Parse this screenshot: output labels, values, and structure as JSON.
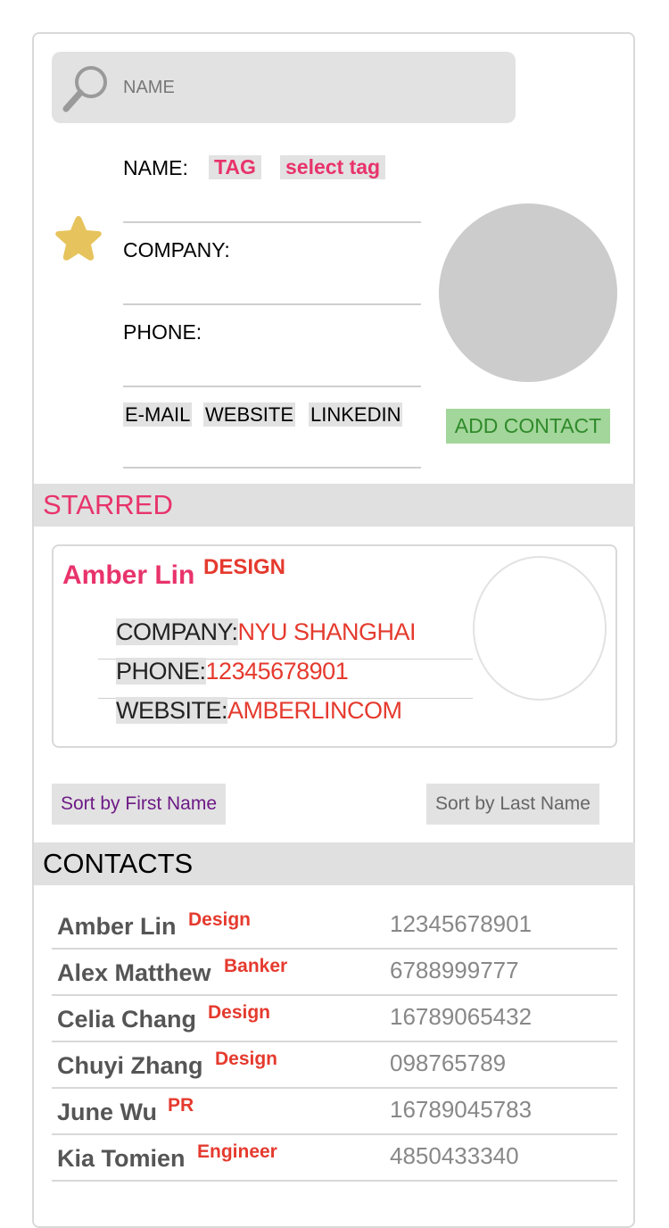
{
  "search": {
    "placeholder": "NAME"
  },
  "form": {
    "name_label": "NAME:",
    "tag_label": "TAG",
    "select_tag_label": "select tag",
    "company_label": "COMPANY:",
    "phone_label": "PHONE:",
    "email_label": "E-MAIL",
    "website_label": "WEBSITE",
    "linkedin_label": "LINKEDIN",
    "add_contact_label": "ADD CONTACT"
  },
  "starred": {
    "heading": "STARRED",
    "card": {
      "name": "Amber Lin",
      "tag": "DESIGN",
      "company_key": "COMPANY:",
      "company_val": "NYU SHANGHAI",
      "phone_key": "PHONE:",
      "phone_val": "12345678901",
      "website_key": "WEBSITE:",
      "website_val": "AMBERLINCOM"
    }
  },
  "sort": {
    "first_label": "Sort by First Name",
    "last_label": "Sort by Last Name"
  },
  "contacts": {
    "heading": "CONTACTS",
    "rows": [
      {
        "name": "Amber Lin",
        "tag": "Design",
        "phone": "12345678901"
      },
      {
        "name": "Alex Matthew",
        "tag": "Banker",
        "phone": "6788999777"
      },
      {
        "name": "Celia Chang",
        "tag": "Design",
        "phone": "16789065432"
      },
      {
        "name": "Chuyi Zhang",
        "tag": "Design",
        "phone": "098765789"
      },
      {
        "name": "June Wu",
        "tag": "PR",
        "phone": "16789045783"
      },
      {
        "name": "Kia Tomien",
        "tag": "Engineer",
        "phone": "4850433340"
      }
    ]
  },
  "colors": {
    "accent_pink": "#e8336b",
    "tag_red": "#e53a2e",
    "add_green": "#a3d69a",
    "star_gold": "#e6c35c",
    "sort_purple": "#6d1a86"
  },
  "icons": {
    "search": "search-icon",
    "star": "star-icon"
  }
}
